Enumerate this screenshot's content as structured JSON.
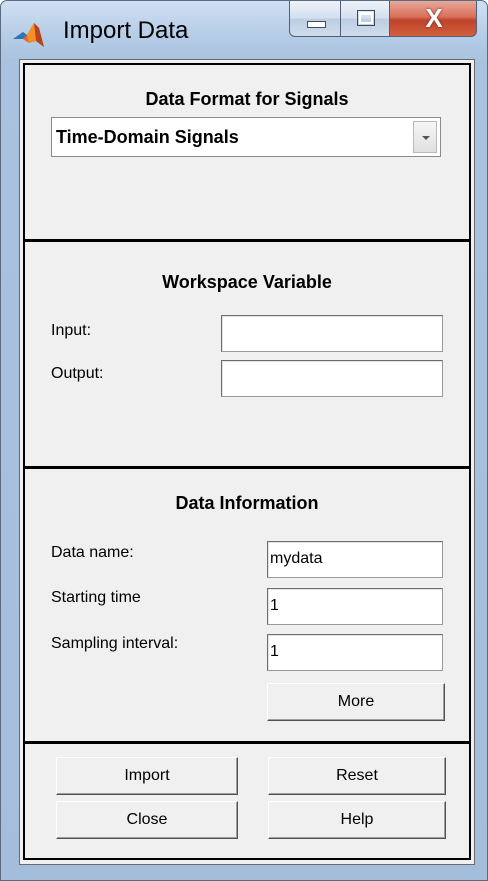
{
  "window": {
    "title": "Import Data",
    "icon": "matlab-icon",
    "controls": {
      "minimize": "minimize-icon",
      "maximize": "maximize-icon",
      "close_glyph": "X"
    }
  },
  "signals": {
    "title": "Data Format for Signals",
    "format_selected": "Time-Domain Signals"
  },
  "workspace": {
    "title": "Workspace Variable",
    "input_label": "Input:",
    "input_value": "",
    "output_label": "Output:",
    "output_value": ""
  },
  "info": {
    "title": "Data Information",
    "name_label": "Data name:",
    "name_value": "mydata",
    "start_label": "Starting time",
    "start_value": "1",
    "interval_label": "Sampling interval:",
    "interval_value": "1",
    "more_label": "More"
  },
  "actions": {
    "import_label": "Import",
    "reset_label": "Reset",
    "close_label": "Close",
    "help_label": "Help"
  }
}
